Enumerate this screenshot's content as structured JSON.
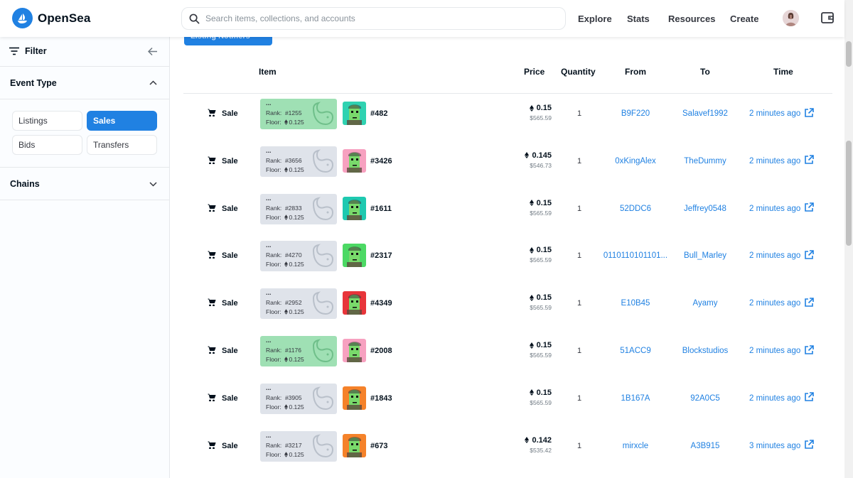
{
  "brand": {
    "name": "OpenSea",
    "accent": "#2081e2"
  },
  "search": {
    "placeholder": "Search items, collections, and accounts"
  },
  "nav": {
    "explore": "Explore",
    "stats": "Stats",
    "resources": "Resources",
    "create": "Create"
  },
  "sidebar": {
    "filter_label": "Filter",
    "event_type_label": "Event Type",
    "event_types": [
      {
        "label": "Listings",
        "selected": false
      },
      {
        "label": "Sales",
        "selected": true
      },
      {
        "label": "Bids",
        "selected": false
      },
      {
        "label": "Transfers",
        "selected": false
      }
    ],
    "chains_label": "Chains"
  },
  "main": {
    "notify_button": "Listing Notifiers",
    "columns": {
      "item": "Item",
      "price": "Price",
      "quantity": "Quantity",
      "from": "From",
      "to": "To",
      "time": "Time"
    },
    "rank_label": "Rank:",
    "floor_label": "Floor:",
    "rows": [
      {
        "event": "Sale",
        "dots": "...",
        "rank": "#1255",
        "floor": "0.125",
        "card": "green",
        "token": "#482",
        "thumb_bg": "#2fd2b1",
        "price_eth": "0.15",
        "price_usd": "$565.59",
        "quantity": "1",
        "from": "B9F220",
        "to": "Salavef1992",
        "time": "2 minutes ago"
      },
      {
        "event": "Sale",
        "dots": "...",
        "rank": "#3656",
        "floor": "0.125",
        "card": "gray",
        "token": "#3426",
        "thumb_bg": "#f7a1c0",
        "price_eth": "0.145",
        "price_usd": "$546.73",
        "quantity": "1",
        "from": "0xKingAlex",
        "to": "TheDummy",
        "time": "2 minutes ago"
      },
      {
        "event": "Sale",
        "dots": "...",
        "rank": "#2833",
        "floor": "0.125",
        "card": "gray",
        "token": "#1611",
        "thumb_bg": "#1ec9b0",
        "price_eth": "0.15",
        "price_usd": "$565.59",
        "quantity": "1",
        "from": "52DDC6",
        "to": "Jeffrey0548",
        "time": "2 minutes ago"
      },
      {
        "event": "Sale",
        "dots": "...",
        "rank": "#4270",
        "floor": "0.125",
        "card": "gray",
        "token": "#2317",
        "thumb_bg": "#4cd964",
        "price_eth": "0.15",
        "price_usd": "$565.59",
        "quantity": "1",
        "from": "0110110101101...",
        "to": "Bull_Marley",
        "time": "2 minutes ago"
      },
      {
        "event": "Sale",
        "dots": "...",
        "rank": "#2952",
        "floor": "0.125",
        "card": "gray",
        "token": "#4349",
        "thumb_bg": "#e8353a",
        "price_eth": "0.15",
        "price_usd": "$565.59",
        "quantity": "1",
        "from": "E10B45",
        "to": "Ayamy",
        "time": "2 minutes ago"
      },
      {
        "event": "Sale",
        "dots": "...",
        "rank": "#1176",
        "floor": "0.125",
        "card": "green",
        "token": "#2008",
        "thumb_bg": "#f7a1c0",
        "price_eth": "0.15",
        "price_usd": "$565.59",
        "quantity": "1",
        "from": "51ACC9",
        "to": "Blockstudios",
        "time": "2 minutes ago"
      },
      {
        "event": "Sale",
        "dots": "...",
        "rank": "#3905",
        "floor": "0.125",
        "card": "gray",
        "token": "#1843",
        "thumb_bg": "#f5822a",
        "price_eth": "0.15",
        "price_usd": "$565.59",
        "quantity": "1",
        "from": "1B167A",
        "to": "92A0C5",
        "time": "2 minutes ago"
      },
      {
        "event": "Sale",
        "dots": "...",
        "rank": "#3217",
        "floor": "0.125",
        "card": "gray",
        "token": "#673",
        "thumb_bg": "#f5822a",
        "price_eth": "0.142",
        "price_usd": "$535.42",
        "quantity": "1",
        "from": "mirxcle",
        "to": "A3B915",
        "time": "3 minutes ago"
      }
    ]
  }
}
